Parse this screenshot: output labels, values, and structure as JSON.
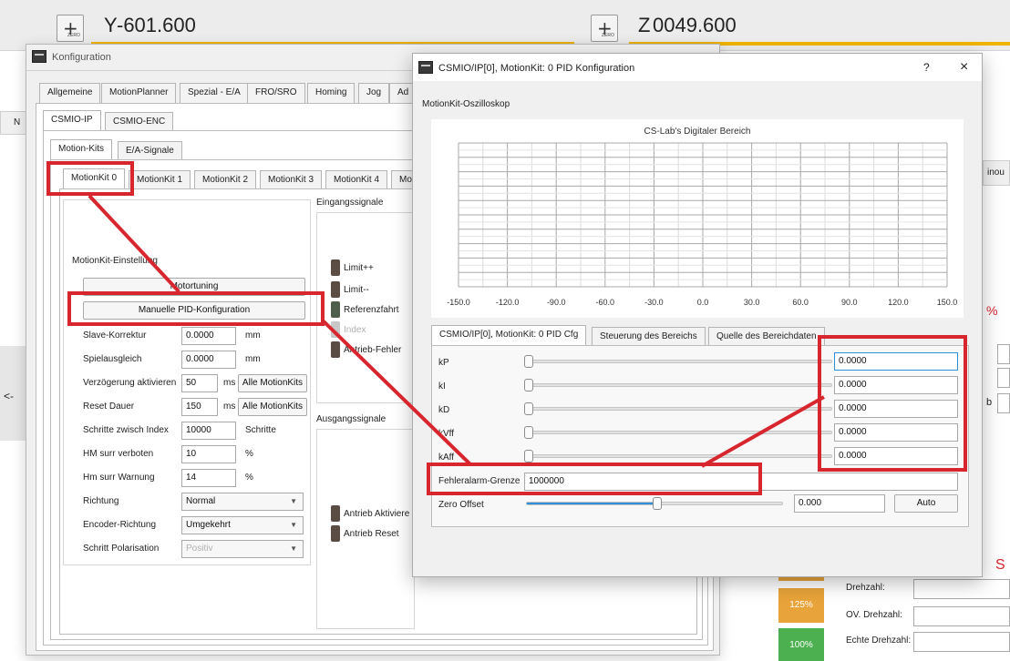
{
  "axes": {
    "y_label": "Y",
    "y_value": "-601.600",
    "z_label": "Z",
    "z_value": "0049.600",
    "zero_icon_label": "ZERO"
  },
  "background": {
    "side_letter": "N",
    "side_arrow": "<-",
    "right_fragment_inou": "inou",
    "right_fragment_percent": "%",
    "right_fragment_b": "b",
    "right_fragment_s": "S",
    "speed_boxes": [
      {
        "label": "125%",
        "color": "#e8a33a"
      },
      {
        "label": "100%",
        "color": "#4caf50"
      }
    ],
    "spindle_labels": [
      "Drehzahl:",
      "OV. Drehzahl:",
      "Echte Drehzahl:"
    ]
  },
  "konfiguration": {
    "title": "Konfiguration",
    "main_tabs": [
      "Allgemeine",
      "MotionPlanner",
      "Spezial - E/A",
      "FRO/SRO",
      "Homing",
      "Jog",
      "Ad"
    ],
    "device_tabs": [
      "CSMIO-IP",
      "CSMIO-ENC"
    ],
    "sub_tabs": [
      "Motion-Kits",
      "E/A-Signale"
    ],
    "motionkit_tabs": [
      "MotionKit 0",
      "MotionKit 1",
      "MotionKit 2",
      "MotionKit 3",
      "MotionKit 4",
      "Mot"
    ],
    "settings_title": "MotionKit-Einstellung",
    "motortuning_button": "Motortuning",
    "manual_pid_button": "Manuelle PID-Konfiguration",
    "rows": [
      {
        "label": "Slave-Korrektur",
        "value": "0.0000",
        "unit": "mm"
      },
      {
        "label": "Spielausgleich",
        "value": "0.0000",
        "unit": "mm"
      },
      {
        "label": "Verzögerung aktivieren",
        "value": "50",
        "unit": "ms",
        "button": "Alle MotionKits"
      },
      {
        "label": "Reset Dauer",
        "value": "150",
        "unit": "ms",
        "button": "Alle MotionKits"
      },
      {
        "label": "Schritte zwisch Index",
        "value": "10000",
        "unit": "Schritte"
      },
      {
        "label": "HM surr verboten",
        "value": "10",
        "unit": "%"
      },
      {
        "label": "Hm surr Warnung",
        "value": "14",
        "unit": "%"
      }
    ],
    "combos": [
      {
        "label": "Richtung",
        "value": "Normal"
      },
      {
        "label": "Encoder-Richtung",
        "value": "Umgekehrt"
      },
      {
        "label": "Schritt Polarisation",
        "value": "Positiv"
      }
    ],
    "input_signals_title": "Eingangssignale",
    "input_signals": [
      "Limit++",
      "Limit--",
      "Referenzfahrt",
      "Index",
      "Antrieb-Fehler"
    ],
    "output_signals_title": "Ausgangssignale",
    "output_signals": [
      "Antrieb Aktiviere",
      "Antrieb Reset"
    ]
  },
  "pid_dialog": {
    "title": "CSMIO/IP[0], MotionKit: 0 PID Konfiguration",
    "help_button": "?",
    "close_button": "×",
    "oscilloscope_label": "MotionKit-Oszilloskop",
    "chart_title": "CS-Lab's Digitaler Bereich",
    "x_ticks": [
      "-150.0",
      "-120.0",
      "-90.0",
      "-60.0",
      "-30.0",
      "0.0",
      "30.0",
      "60.0",
      "90.0",
      "120.0",
      "150.0"
    ],
    "tabs": [
      "CSMIO/IP[0], MotionKit: 0 PID Cfg",
      "Steuerung des Bereichs",
      "Quelle des Bereichdaten"
    ],
    "params": [
      {
        "label": "kP",
        "value": "0.0000"
      },
      {
        "label": "kI",
        "value": "0.0000"
      },
      {
        "label": "kD",
        "value": "0.0000"
      },
      {
        "label": "kVff",
        "value": "0.0000"
      },
      {
        "label": "kAff",
        "value": "0.0000"
      }
    ],
    "fault_label": "Fehleralarm-Grenze",
    "fault_value": "1000000",
    "zero_offset_label": "Zero Offset",
    "zero_offset_value": "0.000",
    "auto_button": "Auto",
    "zero_offset_slider_level": 0.51
  },
  "colors": {
    "annotation_red": "#d7262e",
    "axis_underline": "#f0b400",
    "slider_blue": "#2f8fd8"
  }
}
